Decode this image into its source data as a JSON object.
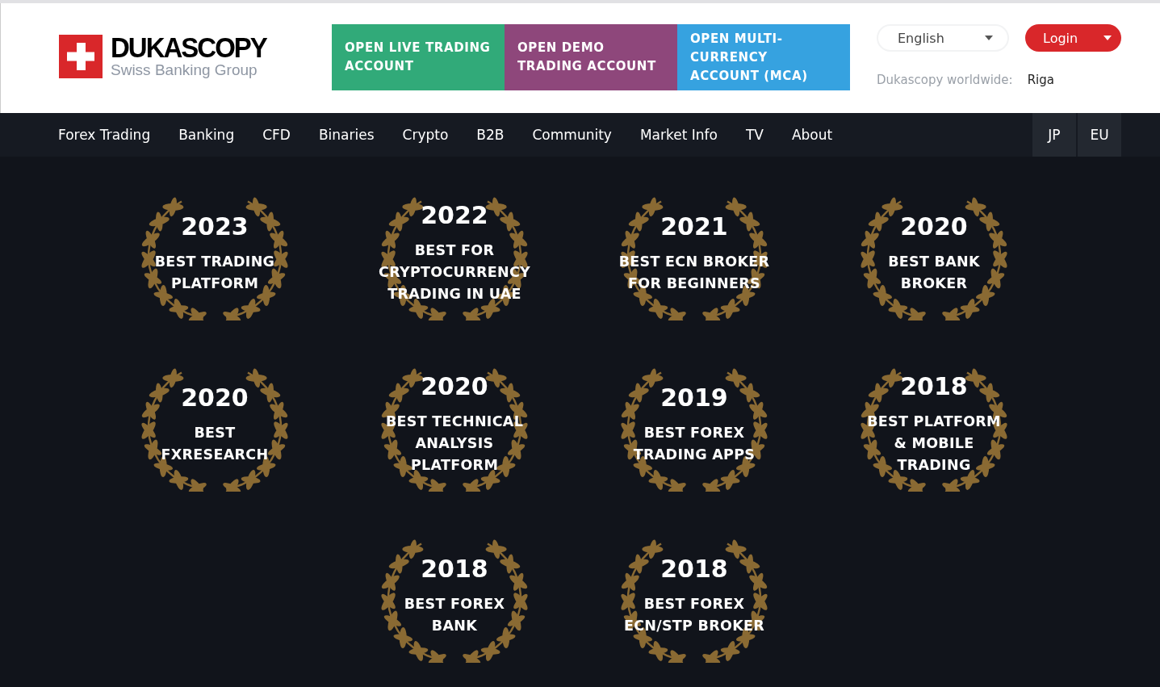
{
  "header": {
    "logo": {
      "name": "DUKASCOPY",
      "tagline": "Swiss Banking Group"
    },
    "account_buttons": [
      {
        "label": "OPEN LIVE TRADING ACCOUNT",
        "color": "#31aa79"
      },
      {
        "label": "OPEN DEMO TRADING ACCOUNT",
        "color": "#8e477b"
      },
      {
        "label": "OPEN MULTI-CURRENCY ACCOUNT (MCA)",
        "color": "#36a2e0"
      }
    ],
    "language": {
      "value": "English"
    },
    "login": {
      "label": "Login"
    },
    "worldwide": {
      "label": "Dukascopy worldwide:",
      "value": "Riga"
    }
  },
  "nav": {
    "items": [
      "Forex Trading",
      "Banking",
      "CFD",
      "Binaries",
      "Crypto",
      "B2B",
      "Community",
      "Market Info",
      "TV",
      "About"
    ],
    "regions": [
      "JP",
      "EU"
    ]
  },
  "award_rows": [
    {
      "awards": [
        {
          "year": "2023",
          "title": "BEST TRADING\nPLATFORM"
        },
        {
          "year": "2022",
          "title": "BEST FOR\nCRYPTOCURRENCY\nTRADING IN UAE"
        },
        {
          "year": "2021",
          "title": "BEST ECN BROKER\nFOR BEGINNERS"
        },
        {
          "year": "2020",
          "title": "BEST BANK\nBROKER"
        }
      ]
    },
    {
      "awards": [
        {
          "year": "2020",
          "title": "BEST FXRESEARCH"
        },
        {
          "year": "2020",
          "title": "BEST TECHNICAL\nANALYSIS\nPLATFORM"
        },
        {
          "year": "2019",
          "title": "BEST FOREX\nTRADING APPS"
        },
        {
          "year": "2018",
          "title": "BEST PLATFORM\n& MOBILE\nTRADING"
        }
      ]
    },
    {
      "awards": [
        {
          "year": "2018",
          "title": "BEST FOREX\nBANK"
        },
        {
          "year": "2018",
          "title": "BEST FOREX\nECN/STP BROKER"
        }
      ]
    }
  ]
}
